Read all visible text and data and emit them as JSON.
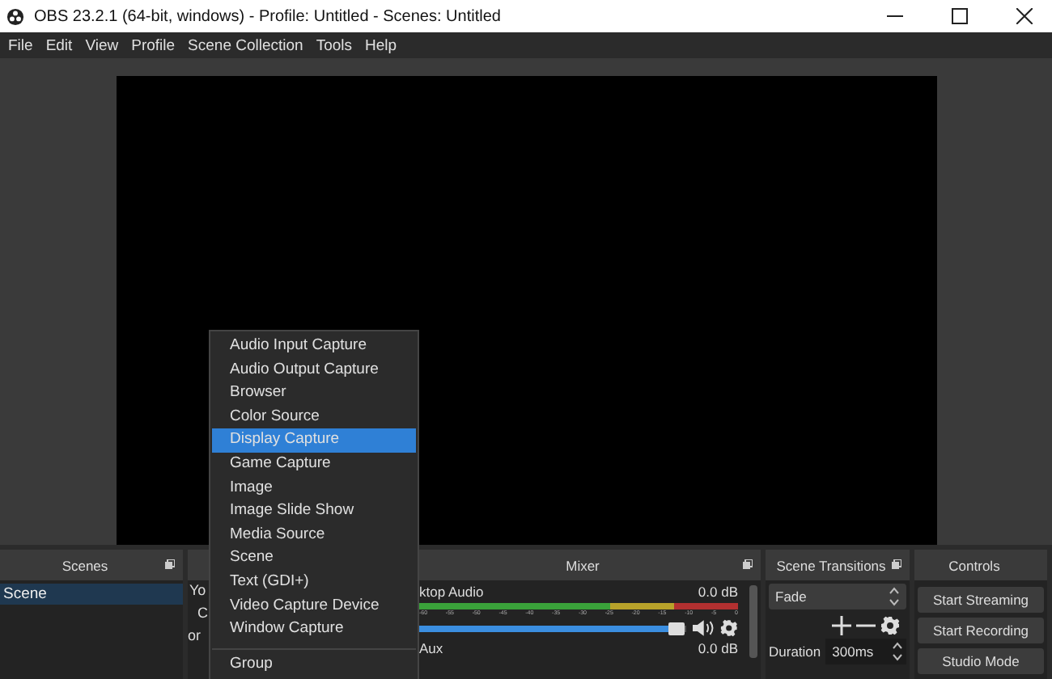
{
  "window": {
    "title": "OBS 23.2.1 (64-bit, windows) - Profile: Untitled - Scenes: Untitled"
  },
  "menu_bar": [
    "File",
    "Edit",
    "View",
    "Profile",
    "Scene Collection",
    "Tools",
    "Help"
  ],
  "scenes": {
    "title": "Scenes",
    "items": [
      {
        "label": "Scene",
        "selected": true
      }
    ]
  },
  "sources": {
    "fragments": [
      "Yo",
      "C",
      "or"
    ]
  },
  "mixer": {
    "title": "Mixer",
    "channels": [
      {
        "name": "ktop Audio",
        "reading": "0.0 dB",
        "level": 0.96,
        "ticks": [
          "-60",
          "-55",
          "-50",
          "-45",
          "-40",
          "-35",
          "-30",
          "-25",
          "-20",
          "-15",
          "-10",
          "-5",
          "0"
        ]
      },
      {
        "name": "Aux",
        "reading": "0.0 dB"
      }
    ]
  },
  "scene_transitions": {
    "title": "Scene Transitions",
    "transition": "Fade",
    "duration_label": "Duration",
    "duration": "300ms"
  },
  "controls": {
    "title": "Controls",
    "buttons": [
      "Start Streaming",
      "Start Recording",
      "Studio Mode"
    ]
  },
  "context_menu": {
    "items": [
      {
        "label": "Audio Input Capture",
        "selected": false
      },
      {
        "label": "Audio Output Capture",
        "selected": false
      },
      {
        "label": "Browser",
        "selected": false
      },
      {
        "label": "Color Source",
        "selected": false
      },
      {
        "label": "Display Capture",
        "selected": true
      },
      {
        "label": "Game Capture",
        "selected": false
      },
      {
        "label": "Image",
        "selected": false
      },
      {
        "label": "Image Slide Show",
        "selected": false
      },
      {
        "label": "Media Source",
        "selected": false
      },
      {
        "label": "Scene",
        "selected": false
      },
      {
        "label": "Text (GDI+)",
        "selected": false
      },
      {
        "label": "Video Capture Device",
        "selected": false
      },
      {
        "label": "Window Capture",
        "selected": false
      },
      {
        "label": "Group",
        "selected": false,
        "separated": true
      }
    ]
  }
}
